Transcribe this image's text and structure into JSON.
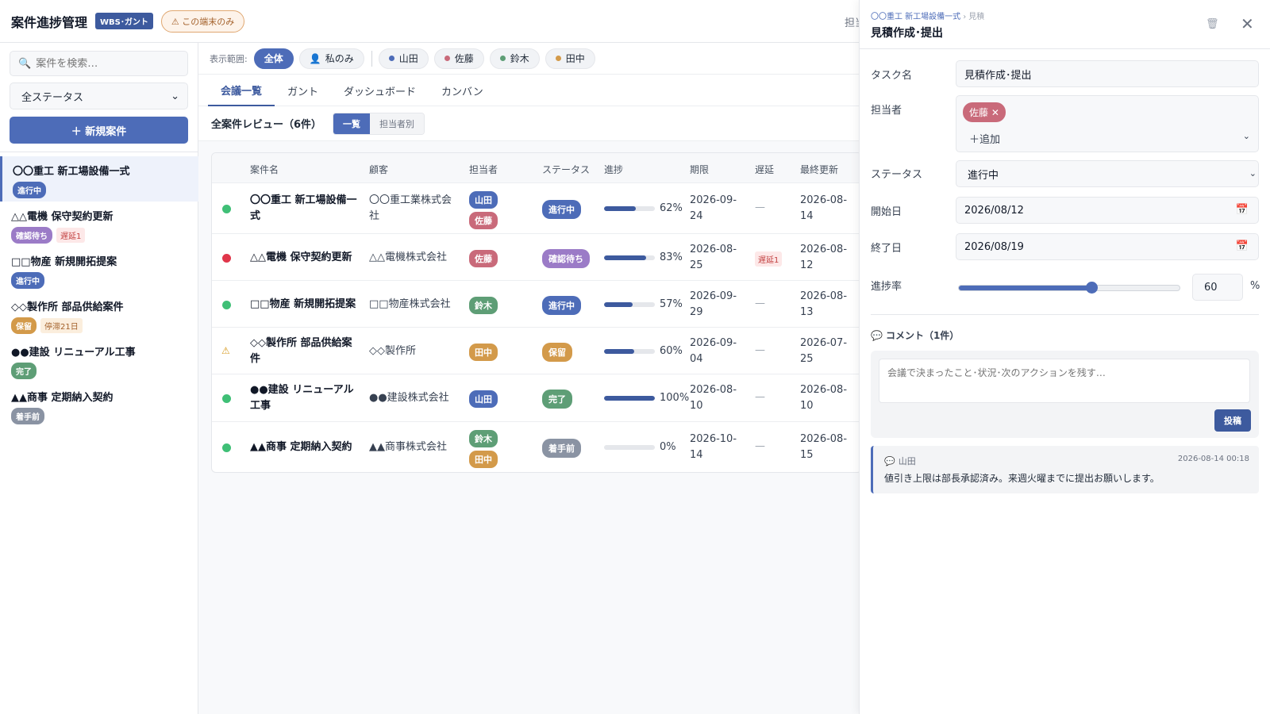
{
  "header": {
    "title": "案件進捗管理",
    "wbs_badge": "WBS･ガント",
    "local_badge": "⚠ この端末のみ",
    "right_text": "担当者"
  },
  "sidebar": {
    "search_placeholder": "案件を検索…",
    "status_filter": "全ステータス",
    "new_button": "＋ 新規案件",
    "projects": [
      {
        "name": "〇〇重工 新工場設備一式",
        "status": "進行中",
        "status_color": "#4d6cb8",
        "flag": "",
        "active": true
      },
      {
        "name": "△△電機 保守契約更新",
        "status": "確認待ち",
        "status_color": "#9b7bc7",
        "flag": "遅延1",
        "flag_type": "delay"
      },
      {
        "name": "□□物産 新規開拓提案",
        "status": "進行中",
        "status_color": "#4d6cb8",
        "flag": ""
      },
      {
        "name": "◇◇製作所 部品供給案件",
        "status": "保留",
        "status_color": "#d39a4a",
        "flag": "停滞21日",
        "flag_type": "stall"
      },
      {
        "name": "●●建設 リニューアル工事",
        "status": "完了",
        "status_color": "#5e9e76",
        "flag": ""
      },
      {
        "name": "▲▲商事 定期納入契約",
        "status": "着手前",
        "status_color": "#8a93a3",
        "flag": ""
      }
    ]
  },
  "filterbar": {
    "label": "表示範囲:",
    "all": "全体",
    "mine": "私のみ",
    "people": [
      {
        "name": "山田",
        "color": "#4d6cb8"
      },
      {
        "name": "佐藤",
        "color": "#c96a7a"
      },
      {
        "name": "鈴木",
        "color": "#5e9e76"
      },
      {
        "name": "田中",
        "color": "#d39a4a"
      }
    ]
  },
  "tabs": [
    "会議一覧",
    "ガント",
    "ダッシュボード",
    "カンバン"
  ],
  "review": {
    "title": "全案件レビュー（6件）",
    "seg_list": "一覧",
    "seg_owner": "担当者別"
  },
  "table": {
    "headers": [
      "案件名",
      "顧客",
      "担当者",
      "ステータス",
      "進捗",
      "期限",
      "遅延",
      "最終更新"
    ],
    "rows": [
      {
        "dot": "#3fbf76",
        "name": "〇〇重工 新工場設備一式",
        "client": "〇〇重工業株式会社",
        "owners": [
          {
            "n": "山田",
            "c": "#4d6cb8"
          },
          {
            "n": "佐藤",
            "c": "#c96a7a"
          }
        ],
        "status": "進行中",
        "status_color": "#4d6cb8",
        "progress": 62,
        "progress_label": "62%",
        "due": "2026-09-24",
        "delay": "—",
        "updated": "2026-08-14"
      },
      {
        "dot": "#e0364a",
        "name": "△△電機 保守契約更新",
        "client": "△△電機株式会社",
        "owners": [
          {
            "n": "佐藤",
            "c": "#c96a7a"
          }
        ],
        "status": "確認待ち",
        "status_color": "#9b7bc7",
        "progress": 83,
        "progress_label": "83%",
        "due": "2026-08-25",
        "delay": "遅延1",
        "updated": "2026-08-12"
      },
      {
        "dot": "#3fbf76",
        "name": "□□物産 新規開拓提案",
        "client": "□□物産株式会社",
        "owners": [
          {
            "n": "鈴木",
            "c": "#5e9e76"
          }
        ],
        "status": "進行中",
        "status_color": "#4d6cb8",
        "progress": 57,
        "progress_label": "57%",
        "due": "2026-09-29",
        "delay": "—",
        "updated": "2026-08-13"
      },
      {
        "dot": "warn",
        "name": "◇◇製作所 部品供給案件",
        "client": "◇◇製作所",
        "owners": [
          {
            "n": "田中",
            "c": "#d39a4a"
          }
        ],
        "status": "保留",
        "status_color": "#d39a4a",
        "progress": 60,
        "progress_label": "60%",
        "due": "2026-09-04",
        "delay": "—",
        "updated": "2026-07-25"
      },
      {
        "dot": "#3fbf76",
        "name": "●●建設 リニューアル工事",
        "client": "●●建設株式会社",
        "owners": [
          {
            "n": "山田",
            "c": "#4d6cb8"
          }
        ],
        "status": "完了",
        "status_color": "#5e9e76",
        "progress": 100,
        "progress_label": "100%",
        "due": "2026-08-10",
        "delay": "—",
        "updated": "2026-08-10"
      },
      {
        "dot": "#3fbf76",
        "name": "▲▲商事 定期納入契約",
        "client": "▲▲商事株式会社",
        "owners": [
          {
            "n": "鈴木",
            "c": "#5e9e76"
          },
          {
            "n": "田中",
            "c": "#d39a4a"
          }
        ],
        "status": "着手前",
        "status_color": "#8a93a3",
        "progress": 0,
        "progress_label": "0%",
        "due": "2026-10-14",
        "delay": "—",
        "updated": "2026-08-15"
      }
    ]
  },
  "panel": {
    "crumb_project": "〇〇重工 新工場設備一式",
    "crumb_sep": "›",
    "crumb_current": "見積",
    "title": "見積作成･提出",
    "fields": {
      "task_label": "タスク名",
      "task_value": "見積作成･提出",
      "assignee_label": "担当者",
      "assignee_chip": "佐藤 ✕",
      "add_assignee": "＋追加",
      "status_label": "ステータス",
      "status_value": "進行中",
      "start_label": "開始日",
      "start_value": "2026/08/12",
      "end_label": "終了日",
      "end_value": "2026/08/19",
      "progress_label": "進捗率",
      "progress_value": "60",
      "progress_unit": "%",
      "progress_fraction": 0.6
    },
    "comments": {
      "heading": "コメント（1件）",
      "placeholder": "会議で決まったこと･状況･次のアクションを残す…",
      "post_button": "投稿",
      "items": [
        {
          "author": "山田",
          "time": "2026-08-14 00:18",
          "text": "値引き上限は部長承認済み。来週火曜までに提出お願いします。"
        }
      ]
    }
  }
}
